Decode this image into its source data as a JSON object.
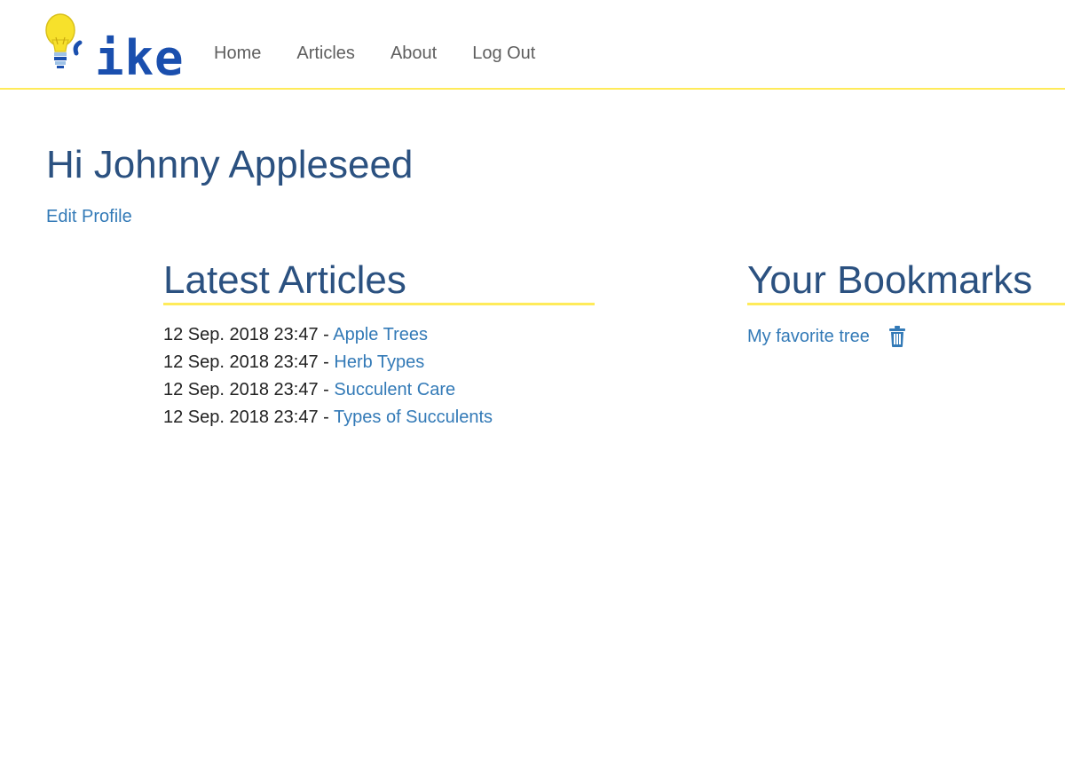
{
  "logo": {
    "text": "ike",
    "bulb_color": "#f7e12b",
    "text_color": "#1a4fae"
  },
  "nav": {
    "items": [
      "Home",
      "Articles",
      "About",
      "Log Out"
    ]
  },
  "greeting": "Hi Johnny Appleseed",
  "edit_profile_label": "Edit Profile",
  "latest_articles": {
    "title": "Latest Articles",
    "items": [
      {
        "date": "12 Sep. 2018 23:47",
        "sep": " - ",
        "title": "Apple Trees"
      },
      {
        "date": "12 Sep. 2018 23:47",
        "sep": " - ",
        "title": "Herb Types"
      },
      {
        "date": "12 Sep. 2018 23:47",
        "sep": " - ",
        "title": "Succulent Care"
      },
      {
        "date": "12 Sep. 2018 23:47",
        "sep": " - ",
        "title": "Types of Succulents"
      }
    ]
  },
  "bookmarks": {
    "title": "Your Bookmarks",
    "items": [
      {
        "title": "My favorite tree",
        "action_icon": "trash-icon"
      }
    ]
  },
  "colors": {
    "accent_yellow": "#ffeb5a",
    "heading_blue": "#2b5180",
    "link_blue": "#337ab7",
    "nav_gray": "#5f5f5f"
  }
}
